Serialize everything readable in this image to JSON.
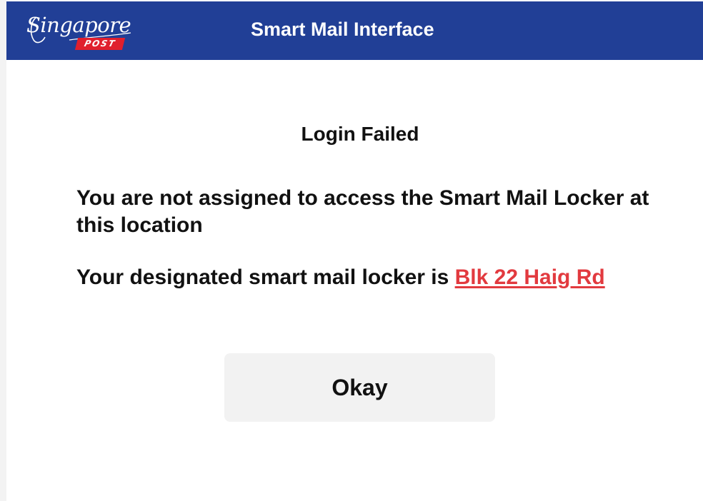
{
  "header": {
    "logo": {
      "script_text": "Singapore",
      "badge_text": "POST"
    },
    "title": "Smart Mail Interface",
    "background_color": "#213f96"
  },
  "dialog": {
    "title": "Login Failed",
    "message": "You are not assigned to access the Smart Mail Locker at this location",
    "designation_prefix": "Your designated smart mail locker is ",
    "locker_location": "Blk 22 Haig Rd",
    "link_color": "#e23a3f",
    "okay_label": "Okay"
  }
}
